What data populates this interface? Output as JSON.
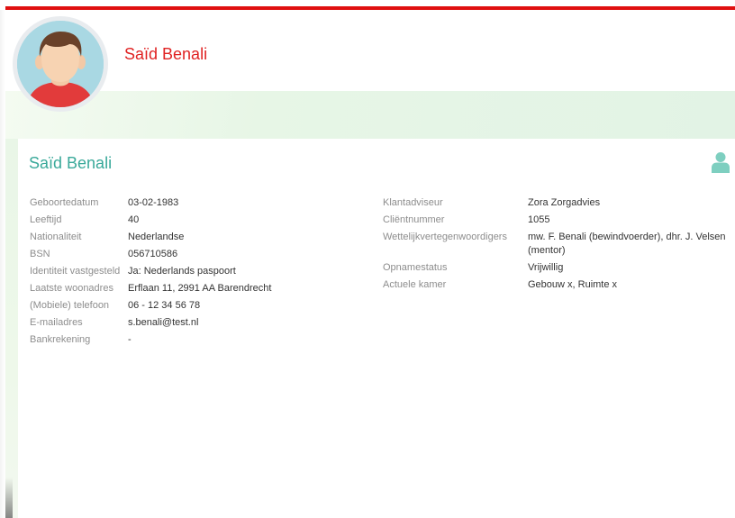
{
  "header": {
    "name": "Saïd Benali"
  },
  "card": {
    "title": "Saïd Benali",
    "left_fields": [
      {
        "label": "Geboortedatum",
        "value": "03-02-1983"
      },
      {
        "label": "Leeftijd",
        "value": "40"
      },
      {
        "label": "Nationaliteit",
        "value": "Nederlandse"
      },
      {
        "label": "BSN",
        "value": "056710586"
      },
      {
        "label": "Identiteit vastgesteld",
        "value": "Ja: Nederlands paspoort"
      },
      {
        "label": "Laatste woonadres",
        "value": "Erflaan 11, 2991 AA Barendrecht"
      },
      {
        "label": "(Mobiele) telefoon",
        "value": "06 - 12 34 56 78"
      },
      {
        "label": "E-mailadres",
        "value": "s.benali@test.nl"
      },
      {
        "label": "Bankrekening",
        "value": "-"
      }
    ],
    "right_fields": [
      {
        "label": "Klantadviseur",
        "value": "Zora Zorgadvies"
      },
      {
        "label": "Cliëntnummer",
        "value": "1055"
      },
      {
        "label": "Wettelijkvertegenwoordigers",
        "value": "mw. F. Benali (bewindvoerder), dhr. J. Velsen (mentor)"
      },
      {
        "label": "Opnamestatus",
        "value": "Vrijwillig"
      },
      {
        "label": "Actuele kamer",
        "value": "Gebouw x, Ruimte x"
      }
    ]
  },
  "icons": {
    "avatar": "male-avatar-icon",
    "person": "person-icon"
  },
  "colors": {
    "accent_red": "#e01010",
    "title_teal": "#3aa99a",
    "icon_teal": "#7ecfc0",
    "band_green": "#e4f4e5"
  }
}
